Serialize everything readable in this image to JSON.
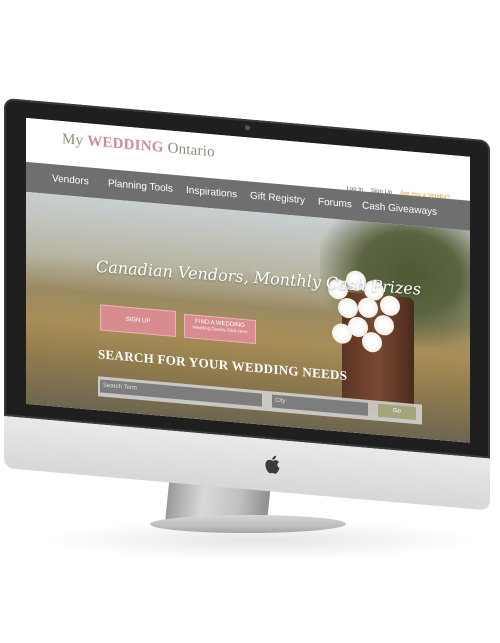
{
  "site": {
    "logo": {
      "my": "My",
      "wedding": "WEDDING",
      "ontario": "Ontario"
    },
    "top_links": {
      "login": "Log In",
      "signup": "Sign Up",
      "vendor": "Are You a Vendor?"
    },
    "nav": [
      "Vendors",
      "Planning Tools",
      "Inspirations",
      "Gift Registry",
      "Forums",
      "Cash Giveaways"
    ],
    "hero": {
      "tagline": "Canadian Vendors, Monthly Cash Prizes",
      "signup_button": "SIGN UP",
      "find_button": "FIND A WEDDING",
      "find_button_sub": "Wedding Guests Click Here",
      "search_title": "SEARCH FOR YOUR WEDDING NEEDS",
      "search_placeholder": "Search Term",
      "city_placeholder": "City",
      "go_button": "Go"
    }
  },
  "colors": {
    "accent_pink": "#d88c8f",
    "nav_gray": "#6f6f6f",
    "go_green": "#a4a57d",
    "vendor_orange": "#e39a3a"
  },
  "icons": [
    "apple-logo-icon",
    "camera-icon"
  ]
}
